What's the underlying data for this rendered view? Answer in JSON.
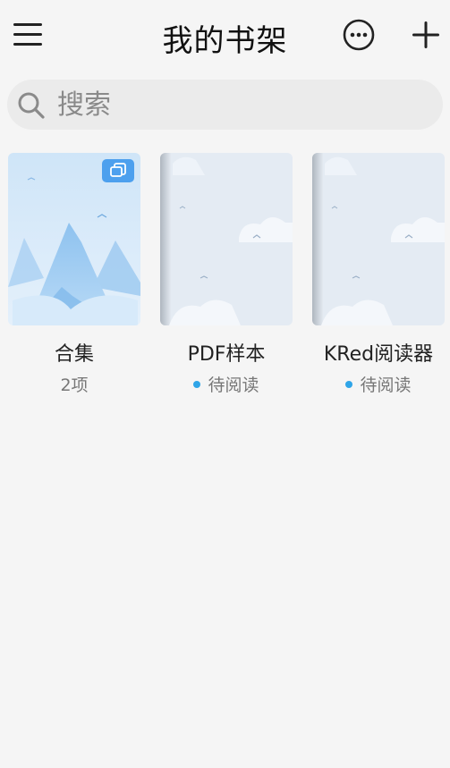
{
  "header": {
    "title": "我的书架",
    "menu_icon": "menu-icon",
    "more_icon": "more-icon",
    "add_icon": "plus-icon"
  },
  "search": {
    "placeholder": "搜索",
    "value": "",
    "icon": "search-icon"
  },
  "books": [
    {
      "title": "合集",
      "subtitle": "2项",
      "badge_icon": "collection-icon"
    },
    {
      "title": "PDF样本",
      "subtitle": "待阅读",
      "status_color": "#2fa5e8"
    },
    {
      "title": "KRed阅读器",
      "subtitle": "待阅读",
      "status_color": "#2fa5e8"
    }
  ],
  "colors": {
    "background": "#f5f5f5",
    "search_bg": "#ebebeb",
    "accent": "#4da0ee",
    "status_dot": "#2fa5e8"
  }
}
